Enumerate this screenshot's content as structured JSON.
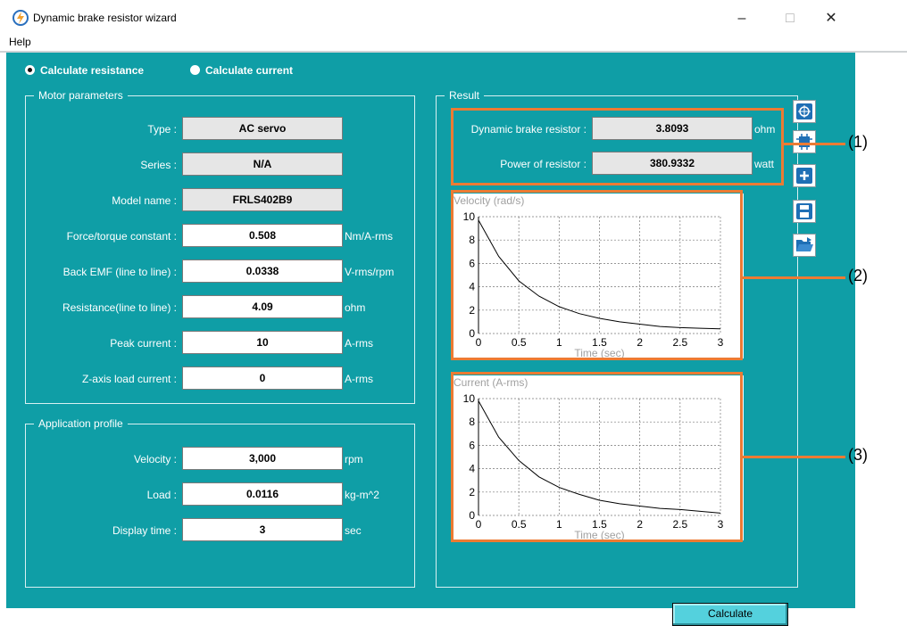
{
  "window": {
    "title": "Dynamic brake resistor wizard",
    "minimize": "–",
    "maximize": "□",
    "close": "✕"
  },
  "menu": {
    "help": "Help"
  },
  "mode": {
    "option1": "Calculate resistance",
    "option2": "Calculate current",
    "selected": "Calculate resistance"
  },
  "motor": {
    "title": "Motor parameters",
    "rows": [
      {
        "label": "Type :",
        "value": "AC servo",
        "unit": "",
        "readonly": true
      },
      {
        "label": "Series :",
        "value": "N/A",
        "unit": "",
        "readonly": true
      },
      {
        "label": "Model name :",
        "value": "FRLS402B9",
        "unit": "",
        "readonly": true
      },
      {
        "label": "Force/torque constant :",
        "value": "0.508",
        "unit": "Nm/A-rms",
        "readonly": false
      },
      {
        "label": "Back EMF (line to line) :",
        "value": "0.0338",
        "unit": "V-rms/rpm",
        "readonly": false
      },
      {
        "label": "Resistance(line to line) :",
        "value": "4.09",
        "unit": "ohm",
        "readonly": false
      },
      {
        "label": "Peak current :",
        "value": "10",
        "unit": "A-rms",
        "readonly": false
      },
      {
        "label": "Z-axis load current :",
        "value": "0",
        "unit": "A-rms",
        "readonly": false
      }
    ]
  },
  "profile": {
    "title": "Application profile",
    "rows": [
      {
        "label": "Velocity :",
        "value": "3,000",
        "unit": "rpm"
      },
      {
        "label": "Load :",
        "value": "0.0116",
        "unit": "kg-m^2"
      },
      {
        "label": "Display time :",
        "value": "3",
        "unit": "sec"
      }
    ]
  },
  "result": {
    "title": "Result",
    "resistor_label": "Dynamic brake resistor :",
    "resistor_value": "3.8093",
    "resistor_unit": "ohm",
    "power_label": "Power of resistor :",
    "power_value": "380.9332",
    "power_unit": "watt"
  },
  "side_buttons": [
    "target-icon",
    "chip-icon",
    "add-icon",
    "save-icon",
    "open-folder-icon"
  ],
  "calculate_label": "Calculate",
  "callouts": [
    "(1)",
    "(2)",
    "(3)"
  ],
  "accent_color": "#ec7b33",
  "background_color": "#0f9ea6",
  "chart_data": [
    {
      "type": "line",
      "title": "Velocity (rad/s)",
      "xlabel": "Time (sec)",
      "ylabel": "",
      "xlim": [
        0,
        3
      ],
      "ylim": [
        0,
        10
      ],
      "xticks": [
        "0",
        "0.5",
        "1",
        "1.5",
        "2",
        "2.5",
        "3"
      ],
      "yticks": [
        "0",
        "2",
        "4",
        "6",
        "8",
        "10"
      ],
      "grid": true,
      "series": [
        {
          "x": [
            0,
            0.25,
            0.5,
            0.75,
            1.0,
            1.25,
            1.5,
            1.75,
            2.0,
            2.25,
            2.5,
            2.75,
            3.0
          ],
          "y": [
            9.7,
            6.6,
            4.5,
            3.2,
            2.3,
            1.7,
            1.3,
            1.0,
            0.8,
            0.6,
            0.5,
            0.45,
            0.4
          ]
        }
      ]
    },
    {
      "type": "line",
      "title": "Current (A-rms)",
      "xlabel": "Time (sec)",
      "ylabel": "",
      "xlim": [
        0,
        3
      ],
      "ylim": [
        0,
        10
      ],
      "xticks": [
        "0",
        "0.5",
        "1",
        "1.5",
        "2",
        "2.5",
        "3"
      ],
      "yticks": [
        "0",
        "2",
        "4",
        "6",
        "8",
        "10"
      ],
      "grid": true,
      "series": [
        {
          "x": [
            0,
            0.25,
            0.5,
            0.75,
            1.0,
            1.25,
            1.5,
            1.75,
            2.0,
            2.25,
            2.5,
            2.75,
            3.0
          ],
          "y": [
            9.8,
            6.7,
            4.7,
            3.3,
            2.4,
            1.8,
            1.3,
            1.0,
            0.8,
            0.6,
            0.5,
            0.35,
            0.2
          ]
        }
      ]
    }
  ]
}
